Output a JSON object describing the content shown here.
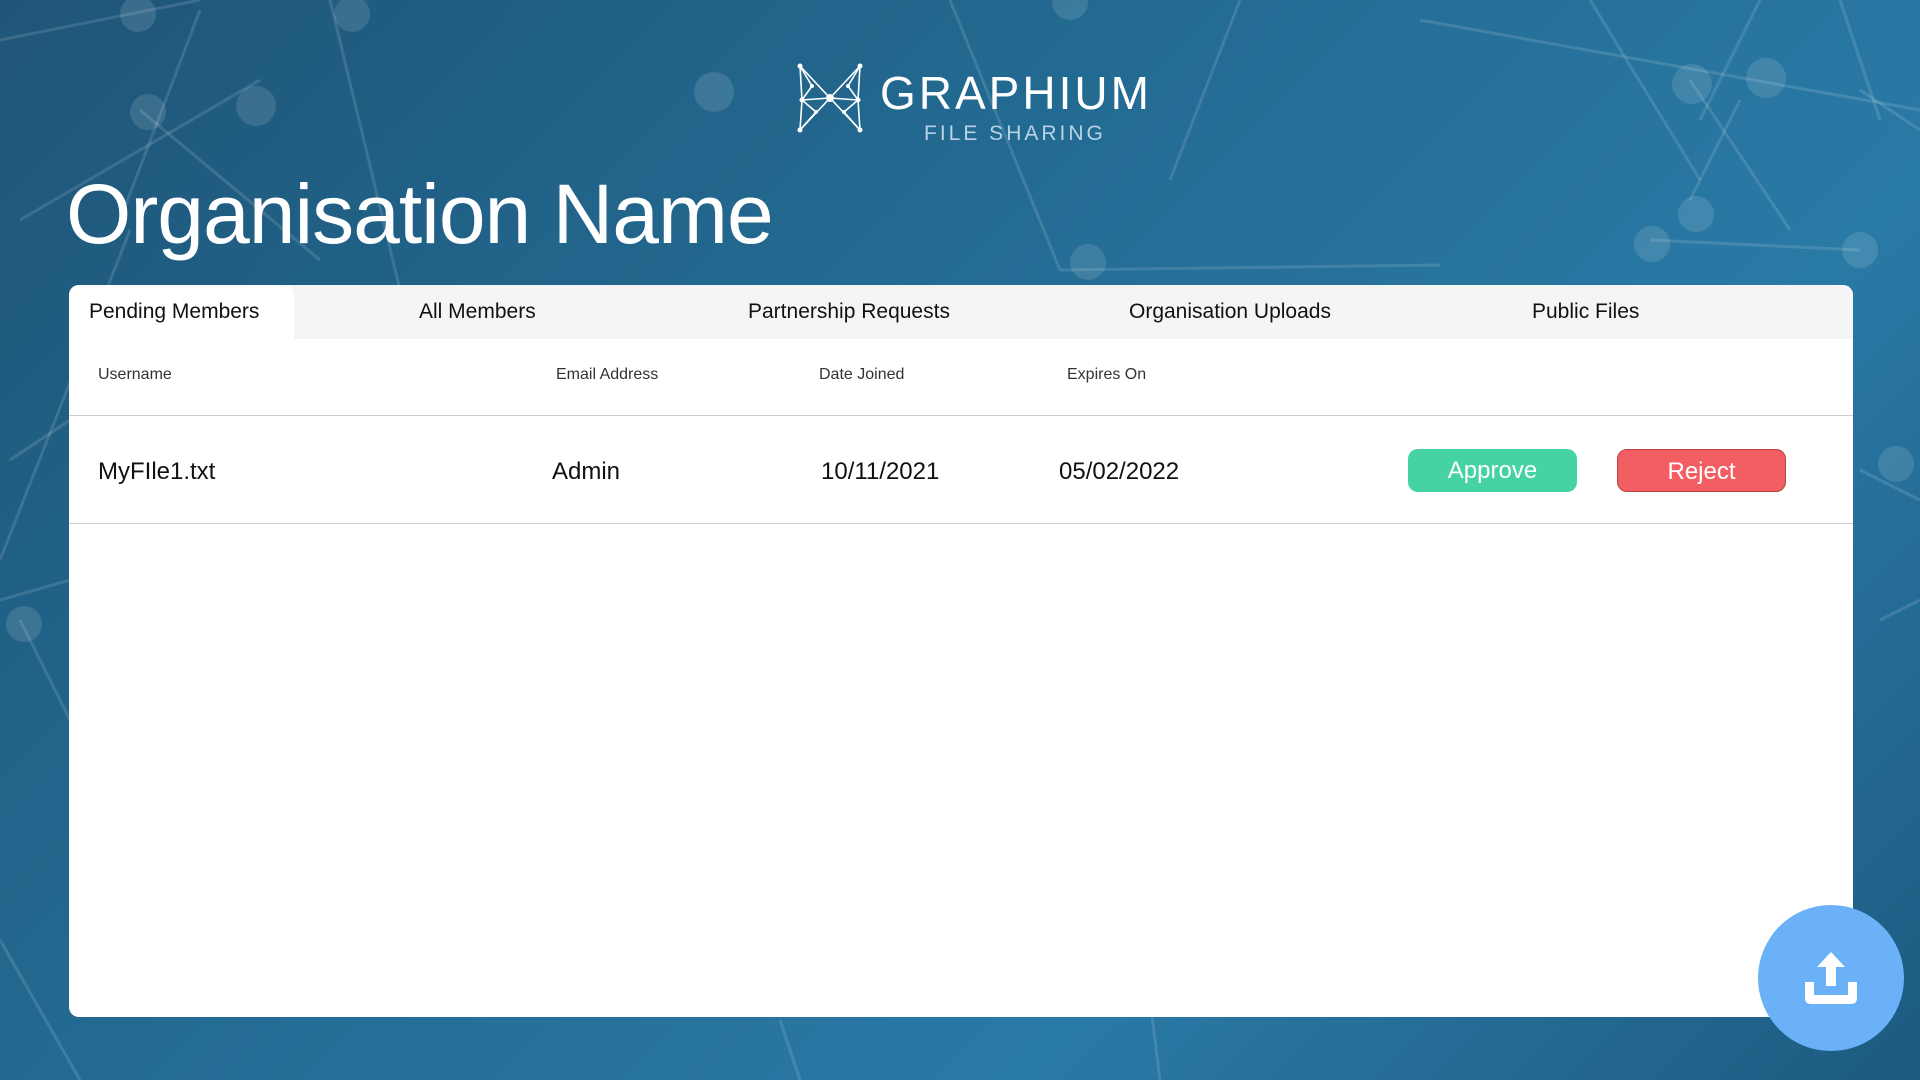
{
  "app": {
    "logo_title": "GRAPHIUM",
    "logo_subtitle": "FILE SHARING",
    "logo_icon": "network-butterfly-icon"
  },
  "page_title": "Organisation Name",
  "tabs": [
    {
      "label": "Pending Members",
      "active": true
    },
    {
      "label": "All Members",
      "active": false
    },
    {
      "label": "Partnership Requests",
      "active": false
    },
    {
      "label": "Organisation Uploads",
      "active": false
    },
    {
      "label": "Public Files",
      "active": false
    }
  ],
  "table": {
    "columns": [
      "Username",
      "Email Address",
      "Date Joined",
      "Expires On"
    ],
    "rows": [
      {
        "username": "MyFIle1.txt",
        "email": "Admin",
        "date_joined": "10/11/2021",
        "expires_on": "05/02/2022",
        "approve_label": "Approve",
        "reject_label": "Reject"
      }
    ]
  },
  "upload_icon": "upload-icon",
  "colors": {
    "background": "#236b93",
    "approve": "#46d3a2",
    "reject": "#f35e62",
    "upload": "#6ab1f7"
  }
}
